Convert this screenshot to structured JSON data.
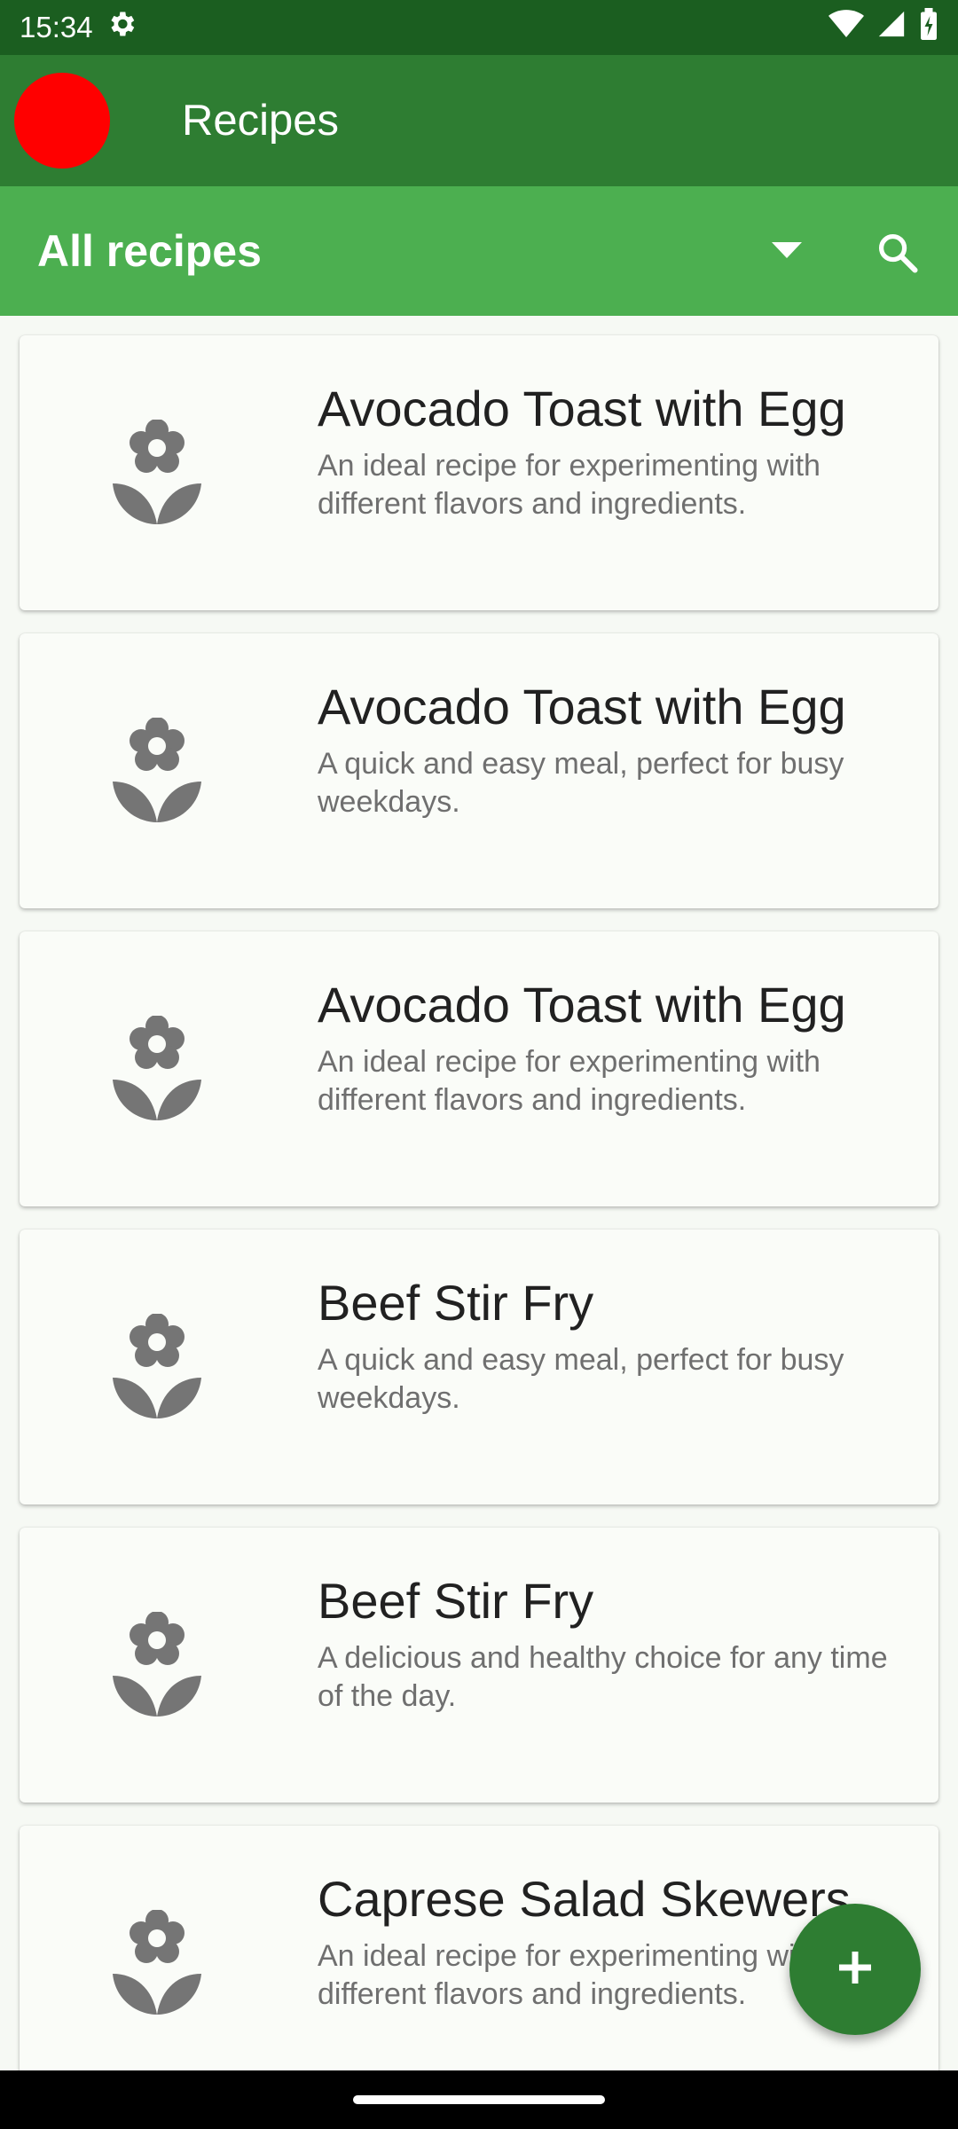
{
  "status_bar": {
    "time": "15:34"
  },
  "app_bar": {
    "title": "Recipes"
  },
  "toolbar": {
    "filter_label": "All recipes"
  },
  "recipes": [
    {
      "title": "Avocado Toast with Egg",
      "description": "An ideal recipe for experimenting with different flavors and ingredients."
    },
    {
      "title": "Avocado Toast with Egg",
      "description": "A quick and easy meal, perfect for busy weekdays."
    },
    {
      "title": "Avocado Toast with Egg",
      "description": "An ideal recipe for experimenting with different flavors and ingredients."
    },
    {
      "title": "Beef Stir Fry",
      "description": "A quick and easy meal, perfect for busy weekdays."
    },
    {
      "title": "Beef Stir Fry",
      "description": "A delicious and healthy choice for any time of the day."
    },
    {
      "title": "Caprese Salad Skewers",
      "description": "An ideal recipe for experimenting with different flavors and ingredients."
    }
  ],
  "icons": {
    "recipe": "flower-icon",
    "add": "plus-icon",
    "search": "search-icon",
    "dropdown": "dropdown-arrow-icon",
    "settings": "gear-icon"
  },
  "colors": {
    "status_bar": "#1b5e20",
    "app_bar": "#2e7d32",
    "toolbar": "#4caf50",
    "fab": "#2e7d32",
    "avatar": "#ff0000",
    "icon_gray": "#757575"
  }
}
